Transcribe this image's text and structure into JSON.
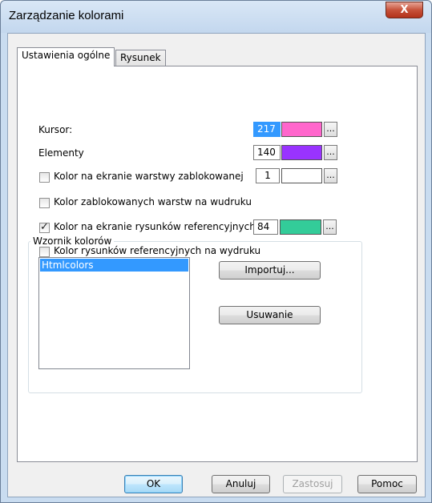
{
  "window": {
    "title": "Zarządzanie kolorami",
    "close_label": "X"
  },
  "tabs": [
    {
      "label": "Ustawienia ogólne",
      "active": true
    },
    {
      "label": "Rysunek",
      "active": false
    }
  ],
  "settings": {
    "cursor": {
      "label": "Kursor:",
      "value": "217",
      "color": "#ff66cc",
      "browse_label": "..."
    },
    "elements": {
      "label": "Elementy",
      "value": "140",
      "color": "#9933ff",
      "browse_label": "..."
    },
    "locked_layers_screen": {
      "label": "Kolor na ekranie warstwy zablokowanej",
      "checked": false,
      "value": "1",
      "color": "#ffffff",
      "browse_label": "..."
    },
    "locked_layers_print": {
      "label": "Kolor zablokowanych warstw na wudruku",
      "checked": false
    },
    "reference_screen": {
      "label": "Kolor na ekranie rysunków referencyjnych",
      "checked": true,
      "value": "84",
      "color": "#33cc99",
      "browse_label": "..."
    },
    "reference_print": {
      "label": "Kolor rysunków referencyjnych na wydruku",
      "checked": false
    }
  },
  "palette_group": {
    "title": "Wzornik kolorów",
    "items": [
      "Htmlcolors"
    ],
    "import_label": "Importuj...",
    "delete_label": "Usuwanie"
  },
  "footer": {
    "ok_label": "OK",
    "cancel_label": "Anuluj",
    "apply_label": "Zastosuj",
    "help_label": "Pomoc"
  }
}
